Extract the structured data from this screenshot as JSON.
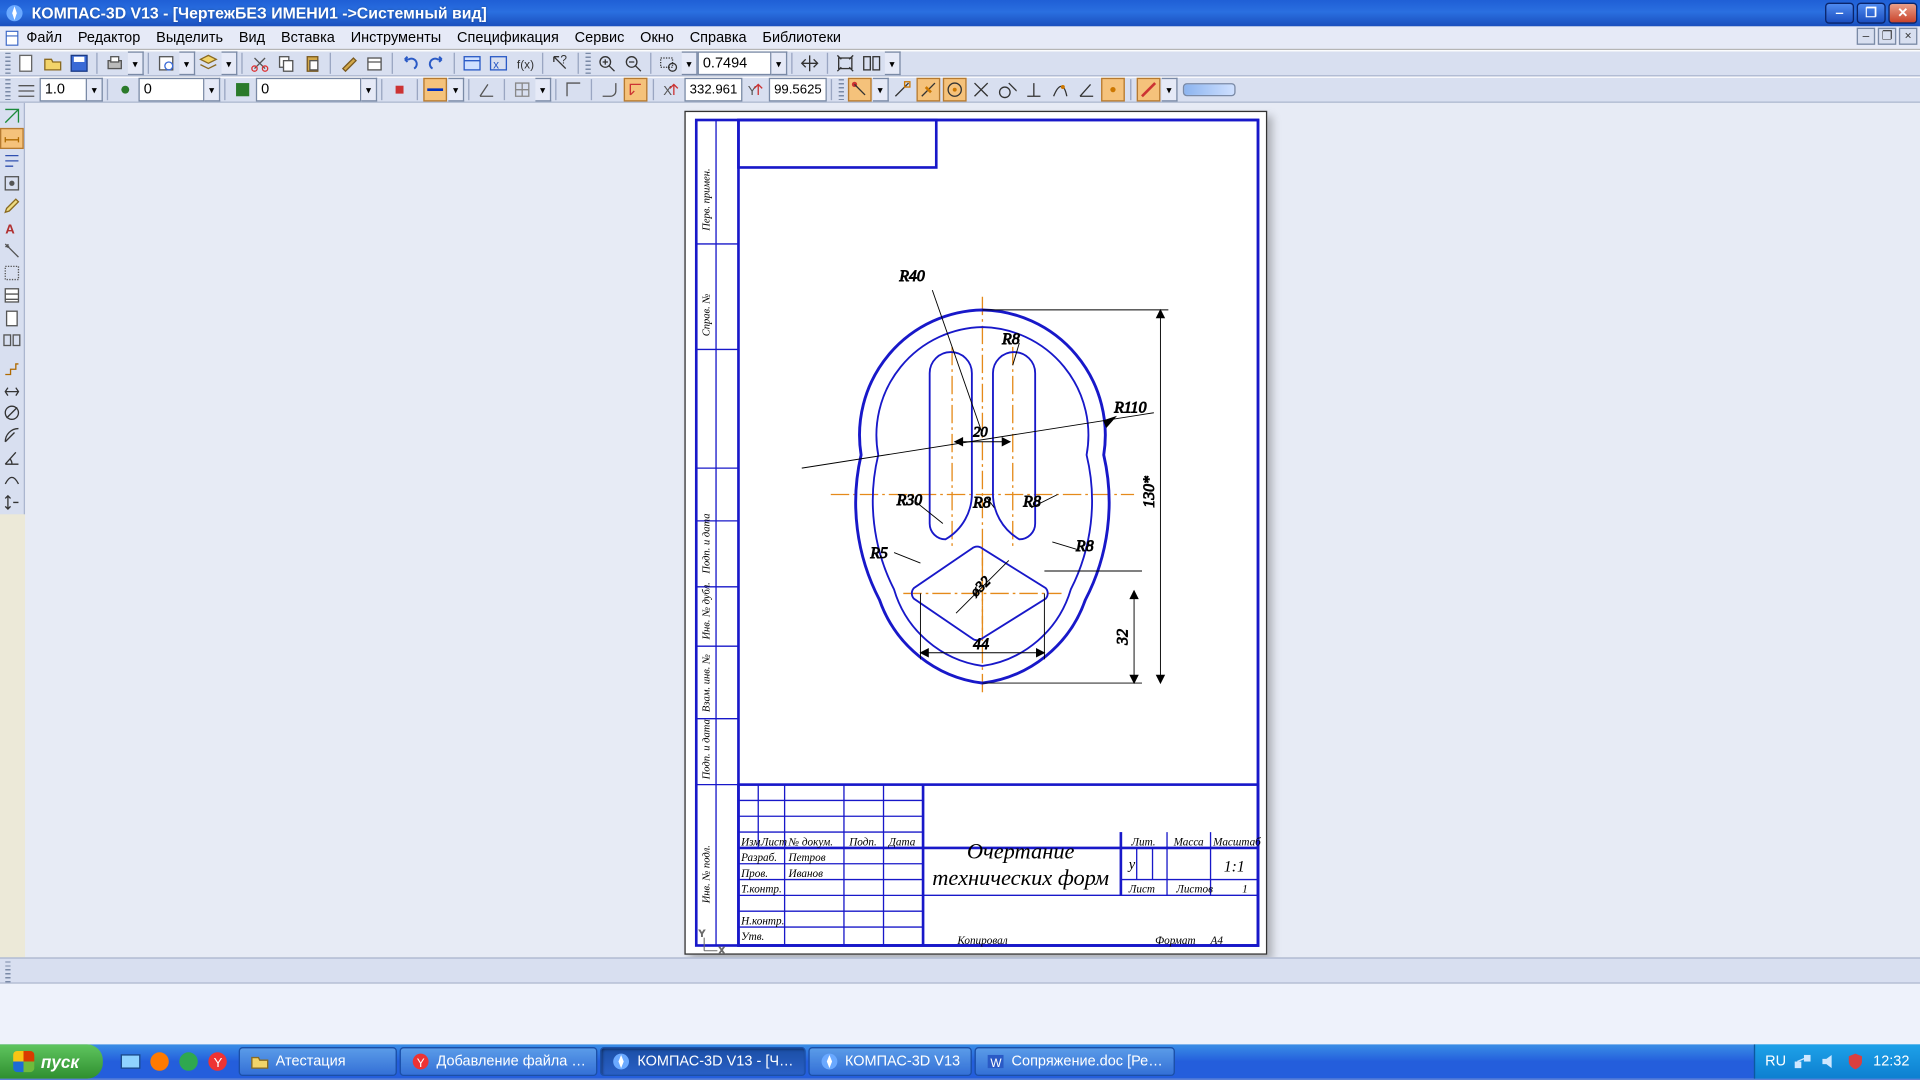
{
  "title": "КОМПАС-3D V13 - [ЧертежБЕЗ ИМЕНИ1 ->Системный вид]",
  "menu": [
    "Файл",
    "Редактор",
    "Выделить",
    "Вид",
    "Вставка",
    "Инструменты",
    "Спецификация",
    "Сервис",
    "Окно",
    "Справка",
    "Библиотеки"
  ],
  "zoom": "0.7494",
  "tb2": {
    "step": "1.0",
    "val1": "0",
    "val2": "0",
    "readout_x": "332.961",
    "readout_y": "99.5625"
  },
  "dims": {
    "r40": "R40",
    "r8a": "R8",
    "r110": "R110",
    "d20": "20",
    "r30": "R30",
    "r8b": "R8",
    "r8c": "R8",
    "r8d": "R8",
    "r5": "R5",
    "d32": "ø32",
    "d44": "44",
    "h32": "32",
    "h130": "130*"
  },
  "stamp": {
    "title1": "Очертание",
    "title2": "технических форм",
    "h_izm": "Изм",
    "h_list": "Лист",
    "h_ndoc": "№ докум.",
    "h_podp": "Подп.",
    "h_data": "Дата",
    "r1": "Разраб.",
    "n1": "Петров",
    "r2": "Пров.",
    "n2": "Иванов",
    "r3": "Т.контр.",
    "r4": "Н.контр.",
    "r5": "Утв.",
    "lit": "Лит.",
    "massa": "Масса",
    "masht": "Масштаб",
    "scale": "1:1",
    "list": "Лист",
    "listov": "Листов",
    "listov_n": "1",
    "litval": "у",
    "kopir": "Копировал",
    "format": "Формат",
    "format_v": "А4"
  },
  "side_labels": [
    "Перв. примен.",
    "Справ. №",
    "Подп. и дата",
    "Инв. № дубл.",
    "Взам. инв. №",
    "Подп. и дата",
    "Инв. № подл."
  ],
  "tasks": [
    {
      "label": "Атестация",
      "active": false
    },
    {
      "label": "Добавление файла …",
      "active": false
    },
    {
      "label": "КОМПАС-3D V13 - [Ч…",
      "active": true
    },
    {
      "label": "КОМПАС-3D V13",
      "active": false
    },
    {
      "label": "Сопряжение.doc [Ре…",
      "active": false
    }
  ],
  "start": "пуск",
  "lang": "RU",
  "clock": "12:32"
}
